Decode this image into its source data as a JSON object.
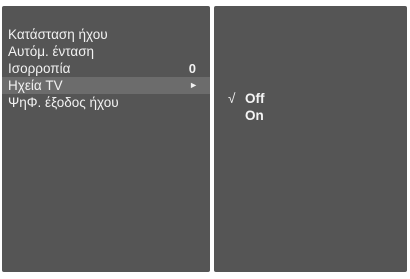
{
  "menu": {
    "items": [
      {
        "label": "Κατάσταση ήχου",
        "value": ""
      },
      {
        "label": "Αυτόμ. ένταση",
        "value": ""
      },
      {
        "label": "Ισορροπία",
        "value": "0"
      },
      {
        "label": "Ηχεία TV",
        "arrow": "►",
        "selected": true
      },
      {
        "label": "ΨηΦ. έξοδος ήχου",
        "value": ""
      }
    ]
  },
  "submenu": {
    "check_mark": "√",
    "options": [
      {
        "label": "Off",
        "checked": true
      },
      {
        "label": "On",
        "checked": false
      }
    ]
  },
  "colors": {
    "panel": "#555555",
    "selected_row": "#6c6c6c",
    "text": "#f2f2f2",
    "background": "#ffffff"
  }
}
